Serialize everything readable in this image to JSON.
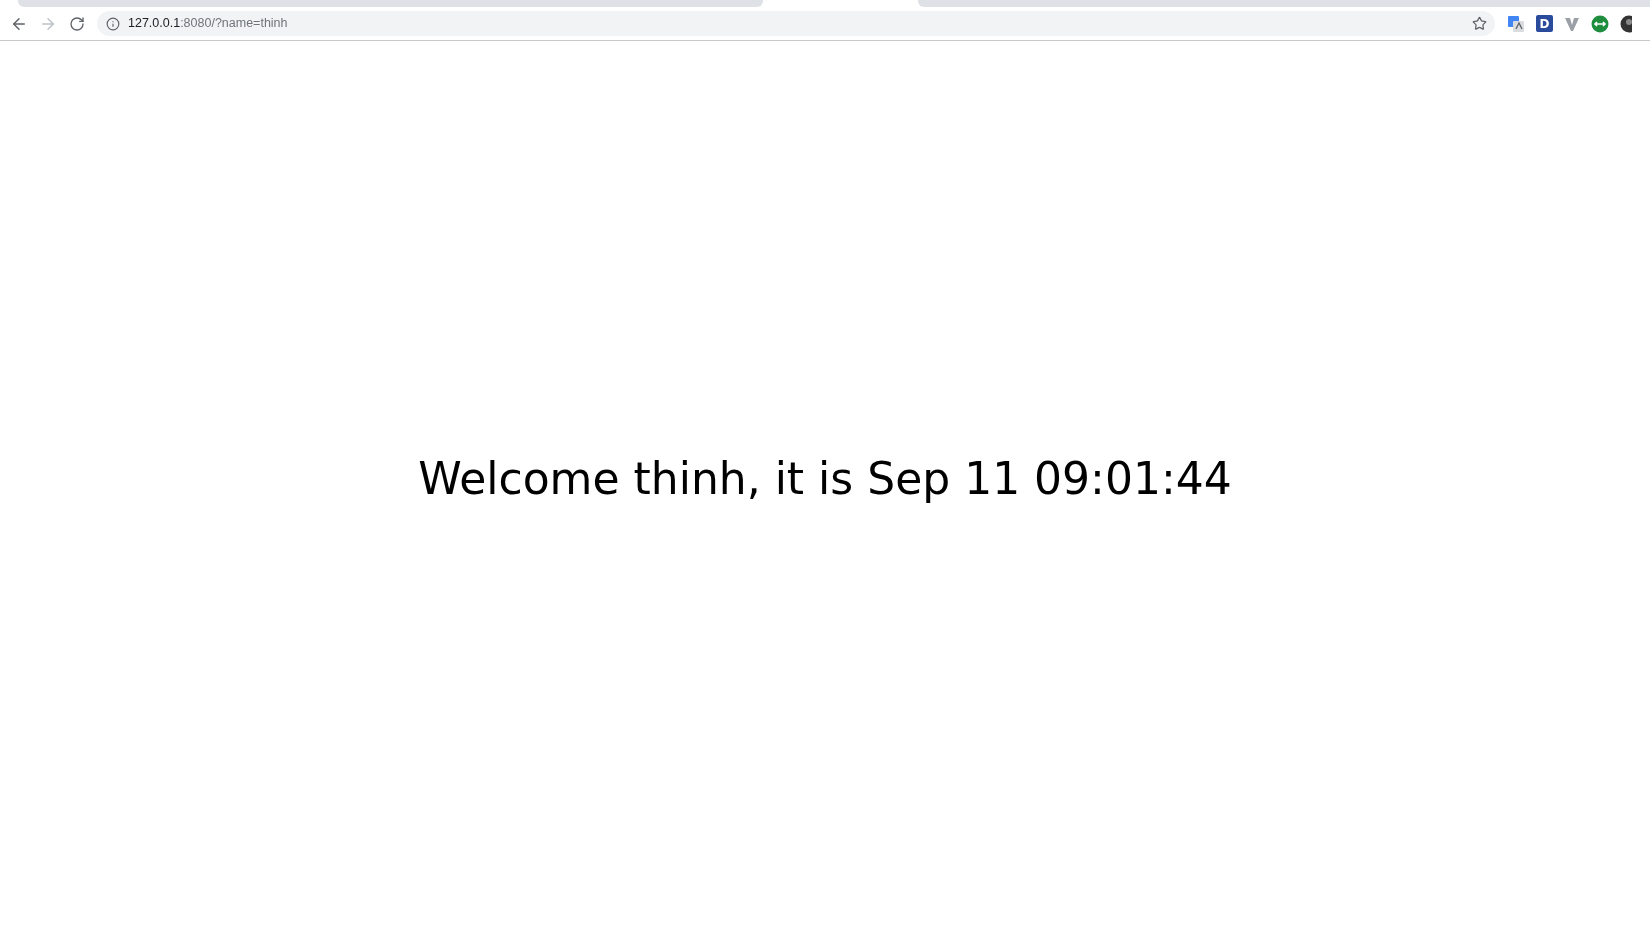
{
  "browser": {
    "address": {
      "host": "127.0.0.1",
      "rest": ":8080/?name=thinh"
    },
    "extensions": [
      {
        "kind": "translate"
      },
      {
        "kind": "letter",
        "text": "D"
      },
      {
        "kind": "v"
      },
      {
        "kind": "arrows"
      },
      {
        "kind": "avatar"
      }
    ]
  },
  "page": {
    "message": "Welcome thinh, it is Sep 11 09:01:44"
  }
}
